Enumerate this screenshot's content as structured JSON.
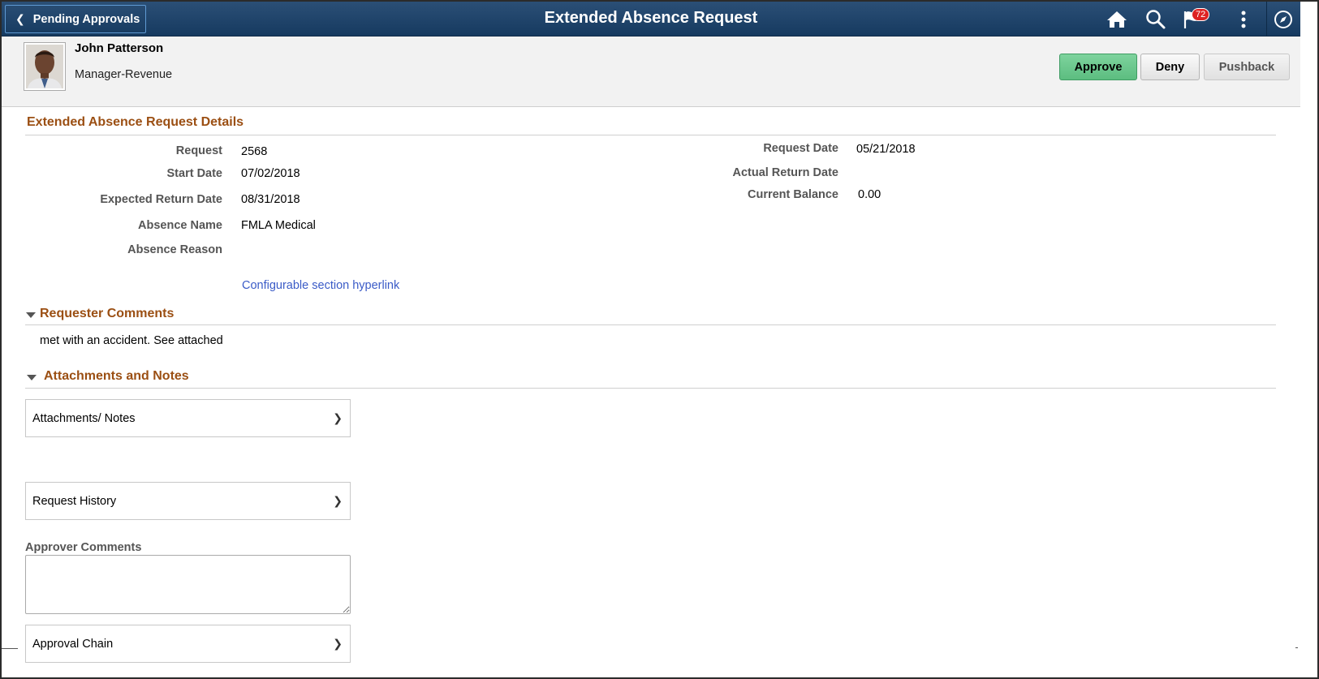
{
  "header": {
    "back_label": "Pending Approvals",
    "title": "Extended Absence Request",
    "notification_count": "72",
    "bg_color": "#1d4068"
  },
  "employee": {
    "name": "John Patterson",
    "title": "Manager-Revenue"
  },
  "actions": {
    "approve": "Approve",
    "deny": "Deny",
    "pushback": "Pushback",
    "approve_color": "#6cc98f"
  },
  "details": {
    "section_title": "Extended Absence Request Details",
    "left": [
      {
        "label": "Request",
        "value": "2568"
      },
      {
        "label": "Start Date",
        "value": "07/02/2018"
      },
      {
        "label": "Expected Return Date",
        "value": "08/31/2018"
      },
      {
        "label": "Absence Name",
        "value": "FMLA Medical"
      },
      {
        "label": "Absence Reason",
        "value": ""
      }
    ],
    "right": [
      {
        "label": "Request Date",
        "value": "05/21/2018"
      },
      {
        "label": "Actual Return Date",
        "value": ""
      },
      {
        "label": "Current Balance",
        "value": "0.00"
      }
    ],
    "link": "Configurable section hyperlink"
  },
  "requester_comments": {
    "title": "Requester Comments",
    "text": "met with an accident. See attached"
  },
  "attachments": {
    "title": "Attachments and Notes",
    "attachments_row": "Attachments/ Notes",
    "history_row": "Request History"
  },
  "approver": {
    "comments_label": "Approver Comments",
    "comments_value": "",
    "approval_chain": "Approval Chain"
  }
}
